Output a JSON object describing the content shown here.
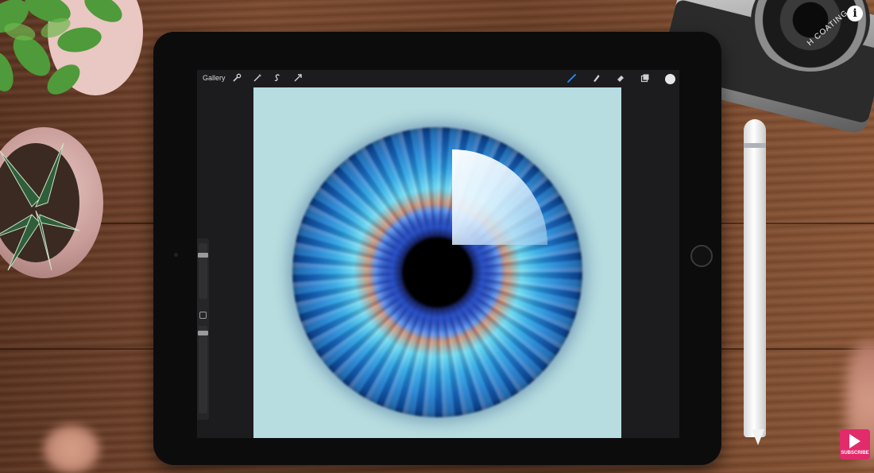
{
  "toolbar": {
    "gallery_label": "Gallery",
    "actions_icon": "wrench-icon",
    "adjustments_icon": "magic-wand-icon",
    "selection_icon": "selection-s-icon",
    "transform_icon": "arrow-transform-icon",
    "brush_icon": "brush-icon",
    "smudge_icon": "smudge-icon",
    "eraser_icon": "eraser-icon",
    "layers_icon": "layers-icon",
    "active_tool": "brush",
    "active_color": "#1e90ff",
    "current_color": "#e6e6e6"
  },
  "lens": {
    "text": "H COATING"
  },
  "overlay": {
    "info_icon_label": "i",
    "subscribe_label": "SUBSCRIBE"
  },
  "canvas": {
    "background": "#b7dde0"
  }
}
